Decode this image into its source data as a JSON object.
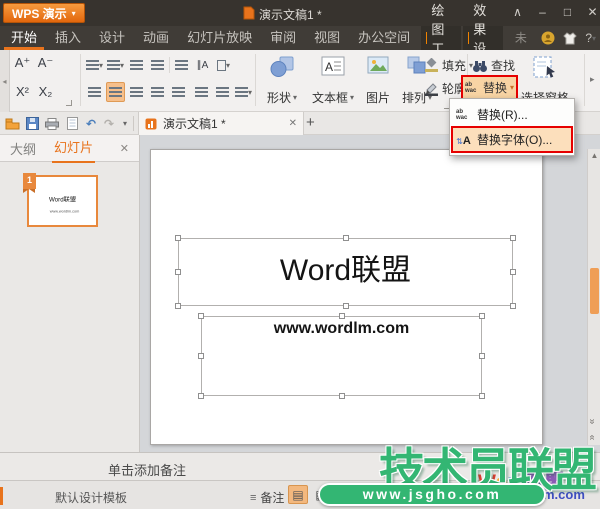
{
  "colors": {
    "accent": "#e8731c",
    "highlight_red": "#e60000",
    "watermark_green": "#33b673"
  },
  "icons": {
    "dropdown": "▾",
    "flyout": "▸",
    "collapse_left": "◂",
    "close": "✕",
    "add": "+",
    "undo": "↶",
    "redo": "↷",
    "double_chevron": "«",
    "scroll_up": "▲",
    "notes_lines": "≡",
    "view_normal": "▤",
    "view_sorter": "▦",
    "help": "?"
  },
  "titlebar": {
    "app_button": "WPS 演示",
    "doc_title": "演示文稿1 *",
    "collapse": "∧",
    "minimize": "–",
    "maximize": "□",
    "close": "✕"
  },
  "menubar": {
    "tabs": [
      "开始",
      "插入",
      "设计",
      "动画",
      "幻灯片放映",
      "审阅",
      "视图",
      "办公空间"
    ],
    "context_tabs": [
      "绘图工具",
      "效果设置"
    ],
    "login_label": "未登录"
  },
  "ribbon": {
    "font_grow": "A⁺",
    "font_shrink": "A⁻",
    "superscript": "X²",
    "subscript": "X₂",
    "shapes": "形状",
    "textbox": "文本框",
    "picture": "图片",
    "arrange": "排列",
    "fill": "填充",
    "outline": "轮廓",
    "find": "查找",
    "replace": "替换",
    "selection_pane": "选择窗格",
    "replace_icon_top": "ab",
    "replace_icon_bottom": "wac",
    "text_direction": "∥A"
  },
  "replace_menu": {
    "items": [
      {
        "label": "替换(R)..."
      },
      {
        "label": "替换字体(O)..."
      }
    ]
  },
  "doc_tab": {
    "title": "演示文稿1 *"
  },
  "left_panel": {
    "outline_tab": "大纲",
    "slides_tab": "幻灯片",
    "slide_number": "1"
  },
  "slide": {
    "title": "Word联盟",
    "subtitle": "www.wordlm.com"
  },
  "notes_placeholder": "单击添加备注",
  "statusbar": {
    "template_name": "默认设计模板",
    "notes_label": "备注"
  },
  "watermark": {
    "title": "技术员联盟",
    "url": "www.jsgho.com",
    "logo_letters": [
      "W",
      "o",
      "r",
      "d",
      "联盟"
    ],
    "logo_suffix": "m.com"
  }
}
